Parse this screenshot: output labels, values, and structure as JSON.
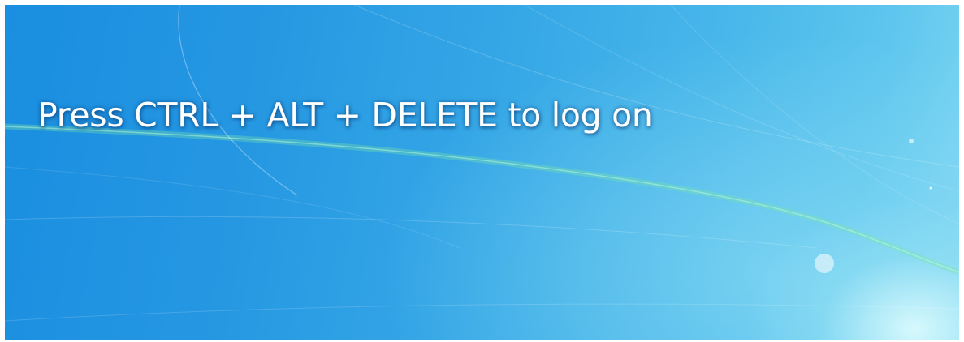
{
  "logon_screen": {
    "message": "Press CTRL + ALT + DELETE to log on"
  },
  "colors": {
    "background_start": "#1a8ee0",
    "background_end": "#7fd6f2",
    "text": "#ffffff"
  }
}
